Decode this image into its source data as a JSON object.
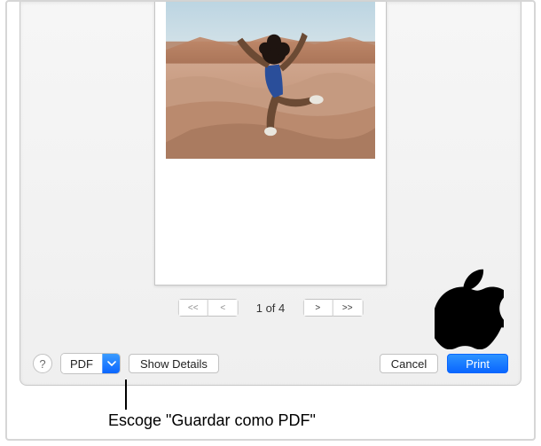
{
  "pager": {
    "first_icon": "<<",
    "prev_icon": "<",
    "label": "1 of 4",
    "next_icon": ">",
    "last_icon": ">>"
  },
  "buttons": {
    "help_label": "?",
    "pdf_label": "PDF",
    "show_details": "Show Details",
    "cancel": "Cancel",
    "print": "Print"
  },
  "annotation": {
    "text": "Escoge \"Guardar como PDF\""
  },
  "photo_alt": "Woman with curly hair posing on desert rocks with arms outstretched"
}
